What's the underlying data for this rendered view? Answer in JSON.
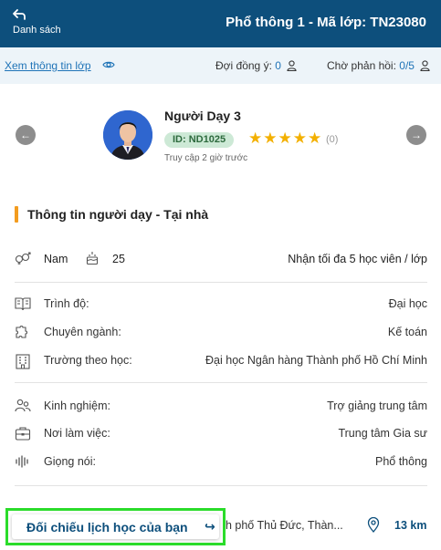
{
  "header": {
    "back_label": "Danh sách",
    "title": "Phổ thông 1 - Mã lớp: TN23080"
  },
  "subbar": {
    "view_info": "Xem thông tin lớp",
    "agreed_label": "Đợi đồng ý: ",
    "agreed_count": "0",
    "pending_label": "Chờ phản hồi: ",
    "pending_count": "0/5"
  },
  "tutor": {
    "name": "Người Dạy 3",
    "id_badge": "ID: ND1025",
    "stars": "★★★★★",
    "rating_count": "(0)",
    "last_access": "Truy cập 2 giờ trước"
  },
  "section": {
    "title": "Thông tin người dạy - Tại nhà"
  },
  "basic": {
    "gender": "Nam",
    "age": "25",
    "max_students": "Nhận tối đa 5 học viên / lớp"
  },
  "details": [
    {
      "label": "Trình độ:",
      "value": "Đại học"
    },
    {
      "label": "Chuyên ngành:",
      "value": "Kế toán"
    },
    {
      "label": "Trường theo học:",
      "value": "Đại học Ngân hàng Thành phố Hồ Chí Minh"
    },
    {
      "label": "Kinh nghiệm:",
      "value": "Trợ giảng trung tâm"
    },
    {
      "label": "Nơi làm việc:",
      "value": "Trung tâm Gia sư"
    },
    {
      "label": "Giọng nói:",
      "value": "Phổ thông"
    }
  ],
  "location": {
    "address": "nh phố Thủ Đức, Thàn...",
    "distance": "13 km"
  },
  "compare_button": {
    "label": "Đối chiếu lịch học của bạn",
    "arrow": "↪"
  },
  "icons": {
    "back": "back-arrow-icon",
    "eye": "eye-icon",
    "user": "user-icon",
    "prev": "chevron-left-icon",
    "next": "chevron-right-icon",
    "gender": "gender-icon",
    "cake": "birthday-cake-icon",
    "book": "book-icon",
    "major": "puzzle-icon",
    "school": "building-icon",
    "experience": "users-icon",
    "workplace": "briefcase-icon",
    "voice": "voice-wave-icon",
    "pin": "map-pin-icon"
  },
  "colors": {
    "header_bg": "#0d4f7c",
    "subbar_bg": "#edf4f9",
    "link_blue": "#1f73b7",
    "accent_orange": "#f39c1f",
    "star_gold": "#f3b000",
    "highlight_green": "#2bdc2b"
  }
}
